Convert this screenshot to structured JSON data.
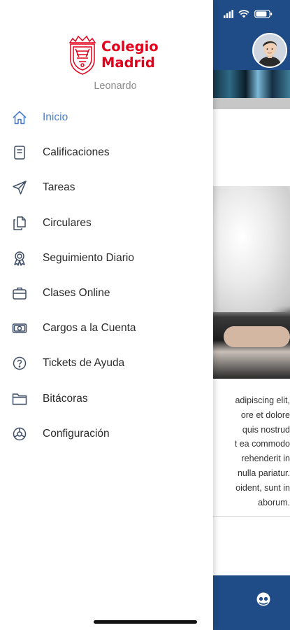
{
  "colors": {
    "brand_red": "#e2001a",
    "primary_blue": "#1f4b86",
    "active_blue": "#4a7ecf",
    "text": "#2b2b2b",
    "muted": "#8c8c8c"
  },
  "logo": {
    "line1": "Colegio",
    "line2": "Madrid",
    "icon": "crest-icon"
  },
  "user": {
    "name": "Leonardo"
  },
  "menu": [
    {
      "label": "Inicio",
      "icon": "home-icon",
      "active": true
    },
    {
      "label": "Calificaciones",
      "icon": "document-icon"
    },
    {
      "label": "Tareas",
      "icon": "send-icon"
    },
    {
      "label": "Circulares",
      "icon": "copy-icon"
    },
    {
      "label": "Seguimiento Diario",
      "icon": "award-icon"
    },
    {
      "label": "Clases Online",
      "icon": "briefcase-icon"
    },
    {
      "label": "Cargos a la Cuenta",
      "icon": "money-icon"
    },
    {
      "label": "Tickets de Ayuda",
      "icon": "help-icon"
    },
    {
      "label": "Bitácoras",
      "icon": "folder-icon"
    },
    {
      "label": "Configuración",
      "icon": "settings-icon"
    }
  ],
  "background": {
    "paragraph": [
      "adipiscing elit,",
      "ore et dolore",
      "quis nostrud",
      "t ea commodo",
      "rehenderit in",
      "nulla pariatur.",
      "oident, sunt in",
      "aborum."
    ],
    "footer_icon": "support-icon"
  }
}
